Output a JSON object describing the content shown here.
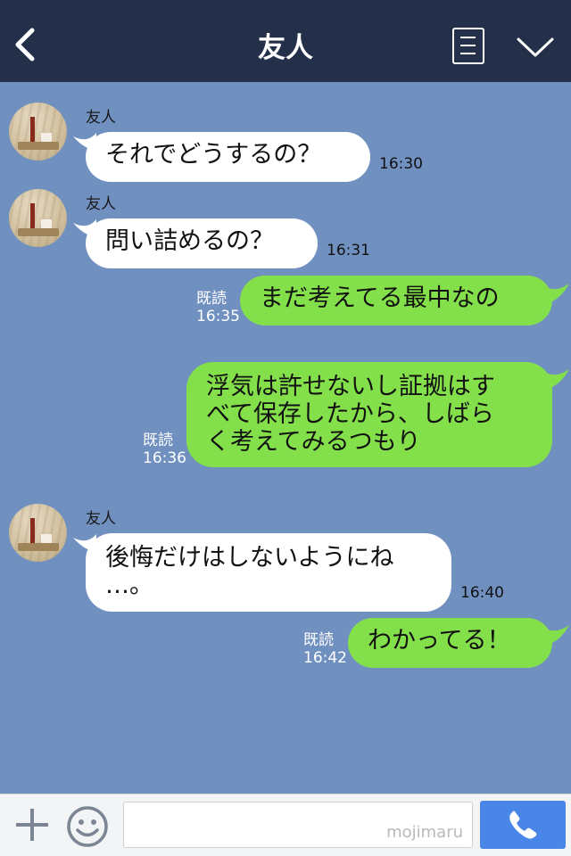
{
  "header": {
    "title": "友人",
    "back_icon": "chevron-left-icon",
    "memo_icon": "notes-icon",
    "menu_icon": "chevron-down-icon"
  },
  "messages": [
    {
      "side": "in",
      "sender": "友人",
      "text": "それでどうするの？",
      "time": "16:30"
    },
    {
      "side": "in",
      "sender": "友人",
      "text": "問い詰めるの？",
      "time": "16:31"
    },
    {
      "side": "out",
      "read": "既読",
      "text": "まだ考えてる最中なの",
      "time": "16:35"
    },
    {
      "side": "out",
      "read": "既読",
      "text_lines": [
        "浮気は許せないし証拠はす",
        "べて保存したから、しばら",
        "く考えてみるつもり"
      ],
      "time": "16:36"
    },
    {
      "side": "in",
      "sender": "友人",
      "text_lines": [
        "後悔だけはしないようにね",
        "…。"
      ],
      "time": "16:40"
    },
    {
      "side": "out",
      "read": "既読",
      "text": "わかってる！",
      "time": "16:42"
    }
  ],
  "input": {
    "placeholder": "",
    "watermark": "mojimaru",
    "plus_icon": "plus-icon",
    "emoji_icon": "smiley-icon",
    "call_icon": "phone-icon"
  },
  "colors": {
    "header_bg": "#24304a",
    "chat_bg": "#7090c0",
    "bubble_in": "#ffffff",
    "bubble_out": "#84e04a",
    "call_button": "#4a86e8"
  }
}
